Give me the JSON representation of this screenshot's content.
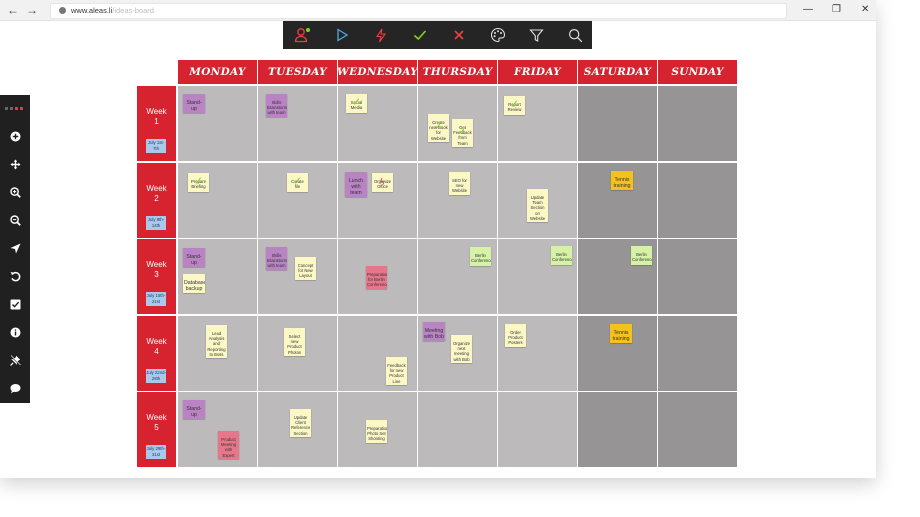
{
  "browser": {
    "back_glyph": "←",
    "forward_glyph": "→",
    "url_host": "www.aleas.li",
    "url_path": "/ideas-board",
    "minimize_glyph": "—",
    "maximize_glyph": "❐",
    "close_glyph": "✕"
  },
  "colors": {
    "accent_red": "#d7232f",
    "cell_weekday": "#bdbabb",
    "cell_weekend": "#979495",
    "toolbar_bg": "#252525",
    "note_yellow": "#fbf8c6",
    "note_purple": "#b983c4",
    "note_green": "#d6f2a6",
    "note_pink": "#e8768a",
    "note_orange": "#f5c21b"
  },
  "toolbar": {
    "items": [
      "user-online-icon",
      "play-icon",
      "flash-icon",
      "check-icon",
      "cross-icon",
      "palette-icon",
      "filter-icon",
      "search-icon"
    ]
  },
  "sidebar": {
    "items": [
      "add-icon",
      "move-icon",
      "zoom-in-icon",
      "zoom-out-icon",
      "navigate-icon",
      "undo-icon",
      "checklist-icon",
      "info-icon",
      "pin-off-icon",
      "chat-icon"
    ]
  },
  "days": [
    "MONDAY",
    "TUESDAY",
    "WEDNESDAY",
    "THURSDAY",
    "FRIDAY",
    "SATURDAY",
    "SUNDAY"
  ],
  "weeks": [
    {
      "label": "Week 1",
      "dates": "July 1st-7th"
    },
    {
      "label": "Week 2",
      "dates": "July 8th-14th"
    },
    {
      "label": "Week 3",
      "dates": "July 15th-21st"
    },
    {
      "label": "Week 4",
      "dates": "July 22nd-28th"
    },
    {
      "label": "Week 5",
      "dates": "July 29th-31st"
    }
  ],
  "notes": [
    {
      "week": 1,
      "day": 1,
      "color": "purple",
      "text": "Stand-up",
      "big": true
    },
    {
      "week": 1,
      "day": 2,
      "color": "purple",
      "text": "Skills Brainstorming with team"
    },
    {
      "week": 1,
      "day": 3,
      "color": "yellow",
      "text": "Social Media",
      "mark": "check"
    },
    {
      "week": 1,
      "day": 4,
      "color": "yellow",
      "text": "Create new Book for Website",
      "mark": "check"
    },
    {
      "week": 1,
      "day": 4,
      "color": "yellow",
      "text": "Get Feedback from Team",
      "mark": "check"
    },
    {
      "week": 1,
      "day": 5,
      "color": "yellow",
      "text": "Report Review",
      "mark": "check"
    },
    {
      "week": 2,
      "day": 1,
      "color": "yellow",
      "text": "Prepare Briefing",
      "mark": "check"
    },
    {
      "week": 2,
      "day": 2,
      "color": "yellow",
      "text": "Create file",
      "mark": "check"
    },
    {
      "week": 2,
      "day": 3,
      "color": "purple",
      "text": "Lunch with team",
      "big": true
    },
    {
      "week": 2,
      "day": 3,
      "color": "yellow",
      "text": "Organize Office",
      "mark": "pink"
    },
    {
      "week": 2,
      "day": 4,
      "color": "yellow",
      "text": "SEO for new Website"
    },
    {
      "week": 2,
      "day": 5,
      "color": "yellow",
      "text": "Update Team Section on Website"
    },
    {
      "week": 2,
      "day": 6,
      "color": "orange",
      "text": "Tennis training",
      "big": true
    },
    {
      "week": 3,
      "day": 1,
      "color": "purple",
      "text": "Stand-up",
      "big": true
    },
    {
      "week": 3,
      "day": 1,
      "color": "yellow",
      "text": "Database backup",
      "big": true
    },
    {
      "week": 3,
      "day": 2,
      "color": "purple",
      "text": "Skills Brainstorming with team"
    },
    {
      "week": 3,
      "day": 2,
      "color": "yellow",
      "text": "Concept for New Layout"
    },
    {
      "week": 3,
      "day": 3,
      "color": "pink",
      "text": "Preparation for Berlin Conference"
    },
    {
      "week": 3,
      "day": 4,
      "color": "green",
      "text": "Berlin Conference"
    },
    {
      "week": 3,
      "day": 5,
      "color": "green",
      "text": "Berlin Conference"
    },
    {
      "week": 3,
      "day": 6,
      "color": "green",
      "text": "Berlin Conference"
    },
    {
      "week": 4,
      "day": 1,
      "color": "yellow",
      "text": "Lead Analysis and Reporting to Boss"
    },
    {
      "week": 4,
      "day": 2,
      "color": "yellow",
      "text": "Select new Product Photos"
    },
    {
      "week": 4,
      "day": 3,
      "color": "yellow",
      "text": "Feedback for new Product Line"
    },
    {
      "week": 4,
      "day": 4,
      "color": "purple",
      "text": "Meeting with Bob",
      "big": true
    },
    {
      "week": 4,
      "day": 4,
      "color": "yellow",
      "text": "Organize next meeting with Bob"
    },
    {
      "week": 4,
      "day": 5,
      "color": "yellow",
      "text": "Order Product Posters"
    },
    {
      "week": 4,
      "day": 6,
      "color": "orange",
      "text": "Tennis training",
      "big": true
    },
    {
      "week": 5,
      "day": 1,
      "color": "purple",
      "text": "Stand-up",
      "big": true
    },
    {
      "week": 5,
      "day": 1,
      "color": "pink",
      "text": "Product Meeting with Expert"
    },
    {
      "week": 5,
      "day": 2,
      "color": "yellow",
      "text": "Update Client Reference Section"
    },
    {
      "week": 5,
      "day": 3,
      "color": "yellow",
      "text": "Preparation Photo Set Shooting"
    }
  ]
}
